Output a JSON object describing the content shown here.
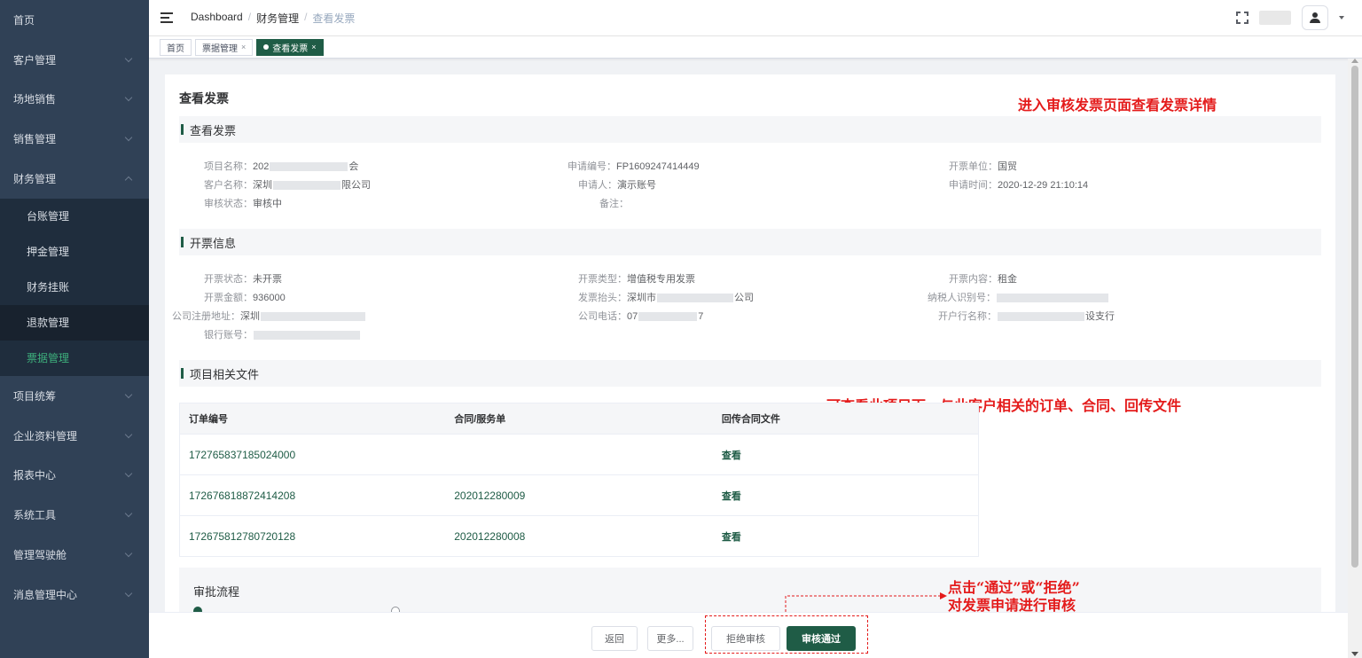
{
  "sidebar": {
    "items": [
      {
        "label": "首页",
        "has_chevron": false
      },
      {
        "label": "客户管理",
        "has_chevron": true
      },
      {
        "label": "场地销售",
        "has_chevron": true
      },
      {
        "label": "销售管理",
        "has_chevron": true
      },
      {
        "label": "财务管理",
        "has_chevron": true,
        "expanded": true
      }
    ],
    "sub_items": [
      "台账管理",
      "押金管理",
      "财务挂账",
      "退款管理",
      "票据管理"
    ],
    "items_after": [
      "项目统筹",
      "企业资料管理",
      "报表中心",
      "系统工具",
      "管理驾驶舱",
      "消息管理中心"
    ]
  },
  "breadcrumb": [
    "Dashboard",
    "财务管理",
    "查看发票"
  ],
  "tags": [
    {
      "label": "首页"
    },
    {
      "label": "票据管理"
    },
    {
      "label": "查看发票"
    }
  ],
  "page": {
    "title": "查看发票",
    "annotation_top": "进入审核发票页面查看发票详情",
    "annotation_table": "可查看此项目下，与此客户相关的订单、合同、回传文件",
    "annotation_action_1": "点击“通过”或“拒绝”",
    "annotation_action_2": "对发票申请进行审核"
  },
  "invoice_section": {
    "title": "查看发票",
    "project_name_label": "项目名称：",
    "project_name_value_a": "202",
    "project_name_value_b": "会",
    "apply_no_label": "申请编号：",
    "apply_no_value": "FP1609247414449",
    "issuer_label": "开票单位：",
    "issuer_value": "国贸",
    "customer_label": "客户名称：",
    "customer_value_a": "深圳",
    "customer_value_b": "限公司",
    "applicant_label": "申请人：",
    "applicant_value": "演示账号",
    "apply_time_label": "申请时间：",
    "apply_time_value": "2020-12-29 21:10:14",
    "audit_status_label": "审核状态：",
    "audit_status_value": "审核中",
    "remark_label": "备注：",
    "remark_value": ""
  },
  "billing_section": {
    "title": "开票信息",
    "status_label": "开票状态：",
    "status_value": "未开票",
    "type_label": "开票类型：",
    "type_value": "增值税专用发票",
    "content_label": "开票内容：",
    "content_value": "租金",
    "amount_label": "开票金额：",
    "amount_value": "936000",
    "header_label": "发票抬头：",
    "header_value_a": "深圳市",
    "header_value_b": "公司",
    "taxid_label": "纳税人识别号：",
    "taxid_value": "",
    "address_label": "公司注册地址：",
    "address_value_a": "深圳",
    "phone_label": "公司电话：",
    "phone_value_a": "07",
    "phone_value_b": "7",
    "bank_label": "开户行名称：",
    "bank_value_b": "设支行",
    "account_label": "银行账号：",
    "account_value": ""
  },
  "files_section": {
    "title": "项目相关文件",
    "columns": [
      "订单编号",
      "合同/服务单",
      "回传合同文件"
    ],
    "rows": [
      {
        "order": "172765837185024000",
        "contract": "",
        "file": "查看"
      },
      {
        "order": "172676818872414208",
        "contract": "202012280009",
        "file": "查看"
      },
      {
        "order": "172675812780720128",
        "contract": "202012280008",
        "file": "查看"
      }
    ]
  },
  "approval_flow": {
    "title": "审批流程"
  },
  "footer": {
    "back": "返回",
    "more": "更多...",
    "reject": "拒绝审核",
    "approve": "审核通过"
  },
  "colors": {
    "primary": "#1f5c46",
    "annotation": "#e41b1b",
    "sidebar_bg": "#304156"
  }
}
